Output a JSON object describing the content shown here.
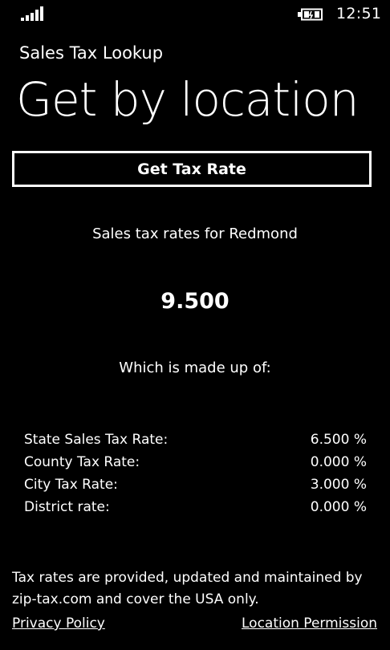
{
  "status_bar": {
    "signal_icon": "signal-strength-icon",
    "battery_icon": "battery-charging-icon",
    "time": "12:51"
  },
  "header": {
    "app_title": "Sales Tax Lookup",
    "page_title": "Get by location"
  },
  "actions": {
    "get_tax_rate_label": "Get Tax Rate"
  },
  "results": {
    "rates_for": "Sales tax rates for Redmond",
    "total_rate": "9.500",
    "made_up_of": "Which is made up of:",
    "rows": [
      {
        "label": "State Sales Tax Rate:",
        "value": "6.500 %"
      },
      {
        "label": "County Tax Rate:",
        "value": "0.000 %"
      },
      {
        "label": "City Tax Rate:",
        "value": "3.000 %"
      },
      {
        "label": "District rate:",
        "value": "0.000 %"
      }
    ]
  },
  "footer": {
    "disclaimer": "Tax rates are provided, updated and maintained by zip-tax.com and cover the USA only.",
    "privacy_link": "Privacy Policy",
    "location_link": "Location Permission"
  },
  "colors": {
    "background": "#000000",
    "foreground": "#ffffff"
  }
}
